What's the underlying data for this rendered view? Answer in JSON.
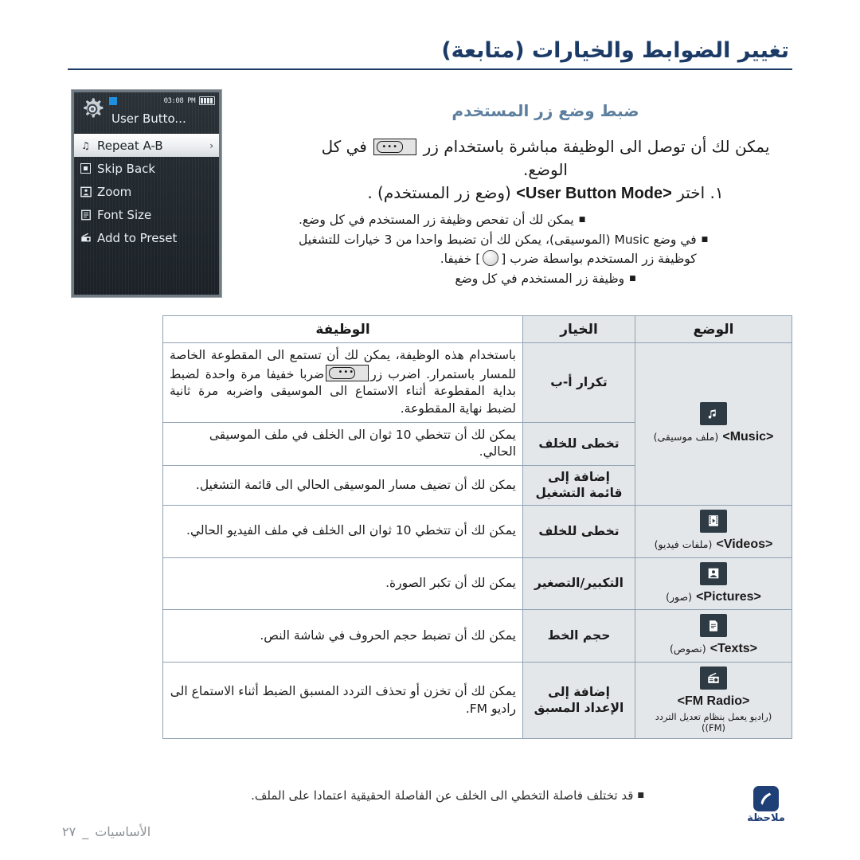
{
  "header": {
    "title": "تغيير الضوابط والخيارات (متابعة)",
    "section_heading": "ضبط وضع زر المستخدم"
  },
  "device": {
    "status_time": "03:08 PM",
    "screen_title": "User Butto...",
    "gear_icon": "gear-icon",
    "battery_icon": "battery-icon",
    "menu_items": [
      {
        "label": "Repeat A-B",
        "icon": "music-note-icon",
        "selected": true,
        "chevron": "›"
      },
      {
        "label": "Skip Back",
        "icon": "skip-back-icon",
        "selected": false,
        "chevron": ""
      },
      {
        "label": "Zoom",
        "icon": "picture-icon",
        "selected": false,
        "chevron": ""
      },
      {
        "label": "Font Size",
        "icon": "text-icon",
        "selected": false,
        "chevron": ""
      },
      {
        "label": "Add to Preset",
        "icon": "radio-icon",
        "selected": false,
        "chevron": ""
      }
    ]
  },
  "body": {
    "intro_before": "يمكن لك أن توصل الى الوظيفة مباشرة باستخدام زر",
    "intro_after": "في كل الوضع.",
    "step1_number": "١.",
    "step1_before": "اختر",
    "step1_en": "<User Button Mode>",
    "step1_after": "(وضع زر المستخدم) .",
    "bullets": [
      "يمكن لك أن تفحص وظيفة زر المستخدم في كل وضع.",
      "في وضع Music (الموسيقى)، يمكن لك أن تضبط واحدا من 3 خيارات للتشغيل كوظيفة زر المستخدم بواسطة ضرب [ ◯ ] خفيفا.",
      "وظيفة زر المستخدم في كل وضع"
    ],
    "bullet2_lead": "في وضع Music (الموسيقى)، يمكن لك أن تضبط واحدا من 3 خيارات للتشغيل",
    "bullet2_tail_before": "كوظيفة زر المستخدم بواسطة ضرب [",
    "bullet2_tail_after": "] خفيفا.",
    "bullet3": "وظيفة زر المستخدم في كل وضع"
  },
  "table": {
    "headers": {
      "mode": "الوضع",
      "option": "الخيار",
      "function": "الوظيفة"
    },
    "rows": [
      {
        "mode_en": "<Music>",
        "mode_ar": "(ملف موسيقى)",
        "mode_icon": "music-note-icon",
        "mode_rowspan": 3,
        "option": "تكرار أ-ب",
        "function_a": "باستخدام هذه الوظيفة، يمكن لك أن تستمع الى المقطوعة الخاصة للمسار باستمرار. اضرب زر",
        "function_b": "ضربا خفيفا مرة واحدة لضبط بداية المقطوعة أثناء الاستماع الى الموسيقى واضربه مرة ثانية لضبط نهاية المقطوعة."
      },
      {
        "option": "تخطى للخلف",
        "function": "يمكن لك أن تتخطي 10 ثوان الى الخلف في ملف الموسيقى الحالي."
      },
      {
        "option": "إضافة إلى قائمة التشغيل",
        "function": "يمكن لك أن تضيف مسار الموسيقى الحالي الى قائمة التشغيل."
      },
      {
        "mode_en": "<Videos>",
        "mode_ar": "(ملفات فيديو)",
        "mode_icon": "video-icon",
        "mode_rowspan": 1,
        "option": "تخطى للخلف",
        "function": "يمكن لك أن تتخطي 10 ثوان الى الخلف في ملف الفيديو الحالي."
      },
      {
        "mode_en": "<Pictures>",
        "mode_ar": "(صور)",
        "mode_icon": "picture-icon",
        "mode_rowspan": 1,
        "option": "التكبير/التصغير",
        "function": "يمكن لك أن تكبر الصورة."
      },
      {
        "mode_en": "<Texts>",
        "mode_ar": "(نصوص)",
        "mode_icon": "text-icon",
        "mode_rowspan": 1,
        "option": "حجم الخط",
        "function": "يمكن لك أن تضبط حجم الحروف في شاشة النص."
      },
      {
        "mode_en": "<FM Radio>",
        "mode_ar": "(راديو يعمل بنظام تعديل التردد (FM))",
        "mode_icon": "radio-icon",
        "mode_rowspan": 1,
        "option": "إضافة إلى الإعداد المسبق",
        "function": "يمكن لك أن تخزن أو تحذف التردد المسبق الضبط أثناء الاستماع الى راديو FM."
      }
    ]
  },
  "note": {
    "label": "ملاحظة",
    "icon": "note-pencil-icon",
    "text": "قد تختلف فاصلة التخطي الى الخلف عن الفاصلة الحقيقية اعتمادا على الملف."
  },
  "footer": {
    "chapter": "الأساسيات",
    "separator": "_",
    "page_number": "٢٧"
  },
  "colors": {
    "title_blue": "#1b3a66",
    "heading_blue": "#5d7f9e",
    "table_border": "#8fa2b4",
    "cell_gray": "#e4e7ea",
    "note_blue": "#1f3f77"
  }
}
